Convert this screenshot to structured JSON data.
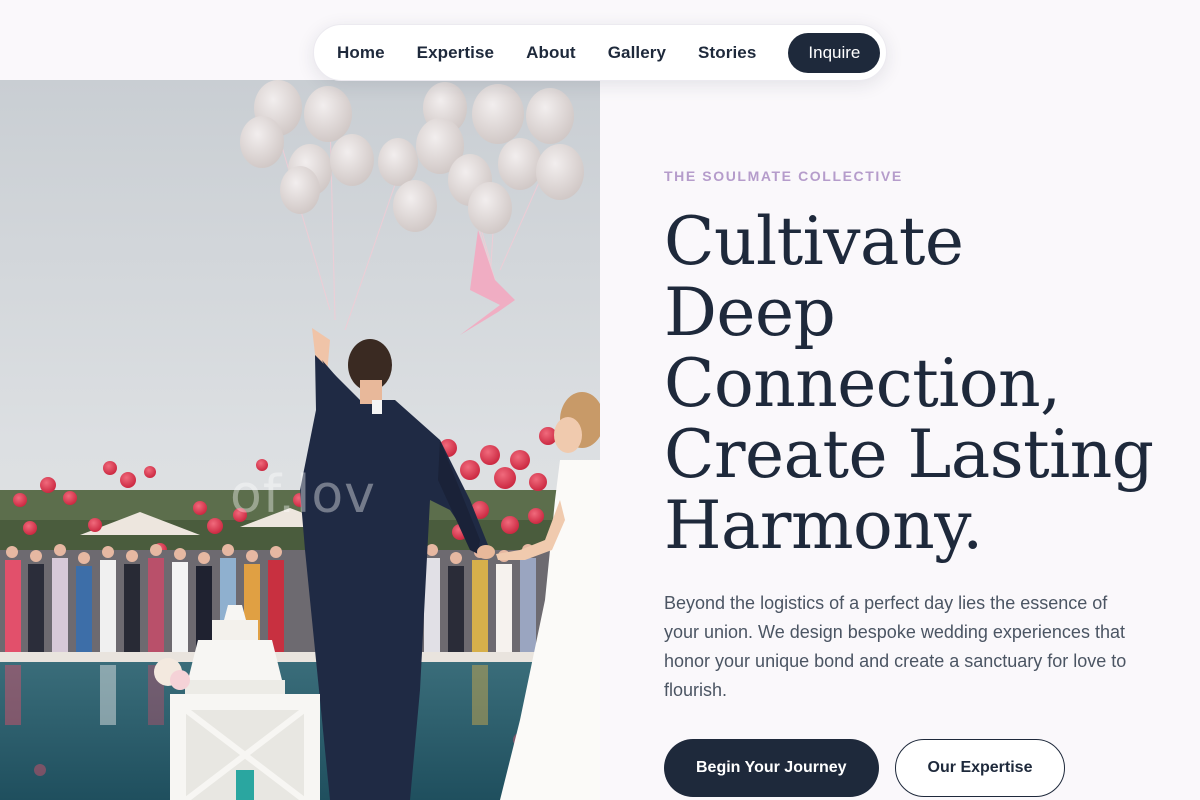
{
  "nav": {
    "items": [
      {
        "label": "Home"
      },
      {
        "label": "Expertise"
      },
      {
        "label": "About"
      },
      {
        "label": "Gallery"
      },
      {
        "label": "Stories"
      }
    ],
    "cta_label": "Inquire"
  },
  "hero": {
    "photo_watermark": "of.lov",
    "eyebrow": "THE SOULMATE COLLECTIVE",
    "headline_lines": [
      "Cultivate",
      "Deep",
      "Connection,",
      "Create Lasting",
      "Harmony."
    ],
    "lede": "Beyond the logistics of a perfect day lies the essence of your union. We design bespoke wedding experiences that honor your unique bond and create a sanctuary for love to flourish.",
    "primary_button": "Begin Your Journey",
    "secondary_button": "Our Expertise"
  },
  "colors": {
    "ink": "#1e293b",
    "accent": "#b59ccb",
    "background": "#faf8fb",
    "body_text": "#4b5563"
  }
}
